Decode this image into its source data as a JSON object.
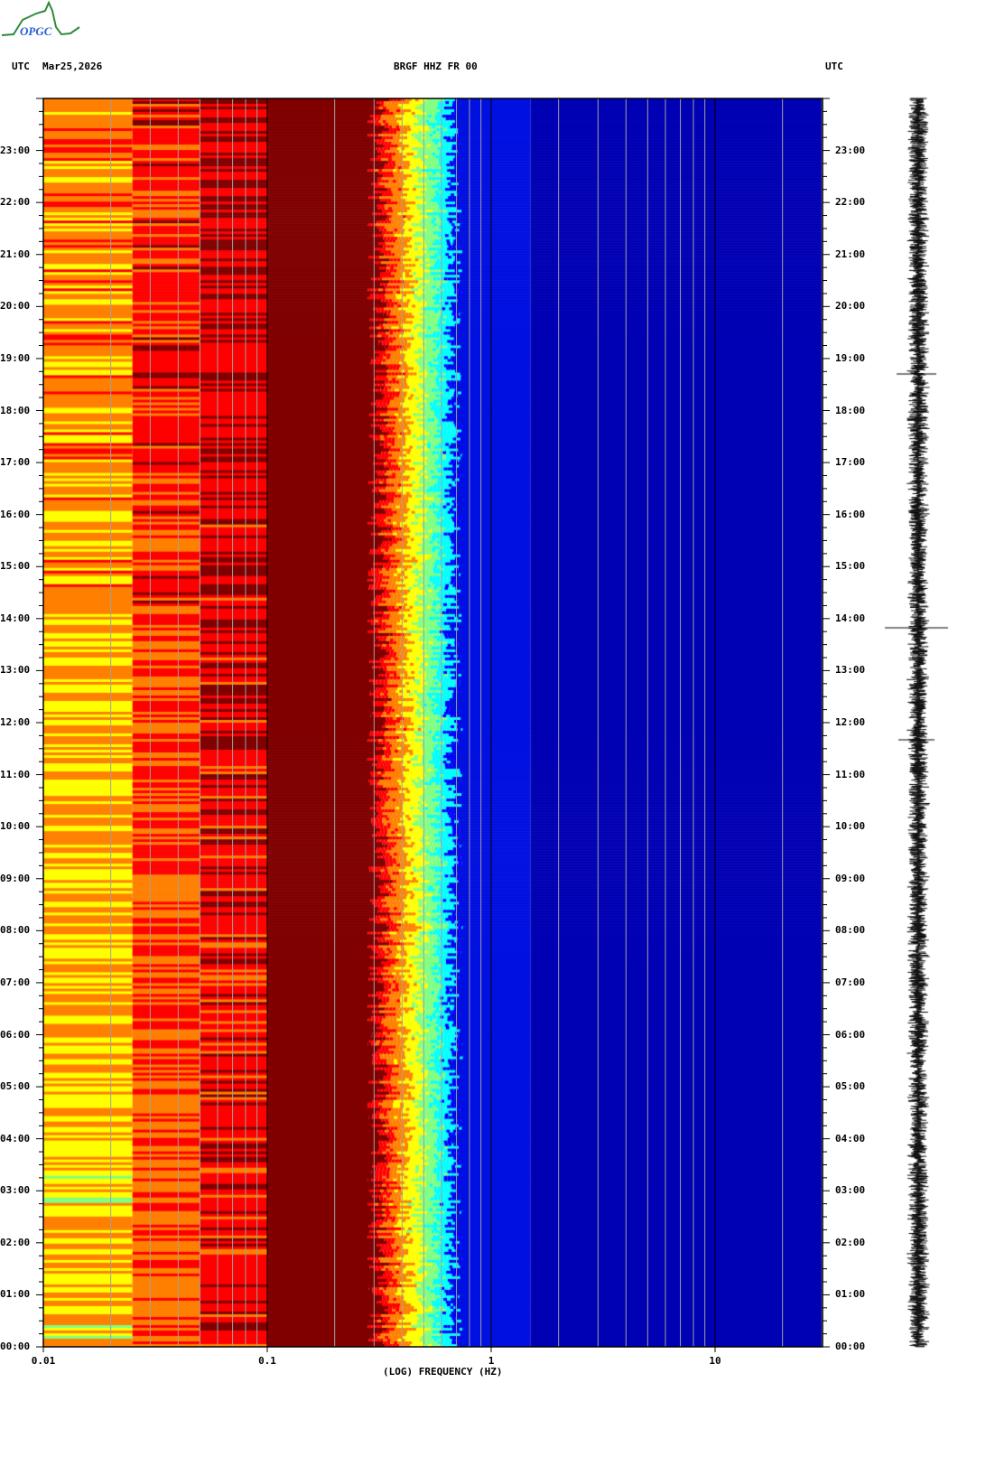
{
  "logo": {
    "text": "OPGC",
    "colors": {
      "curve": "#2e8b3a",
      "text": "#2a5fd0"
    }
  },
  "header": {
    "left_tz": "UTC",
    "date": "Mar25,2026",
    "station": "BRGF HHZ FR 00",
    "right_tz": "UTC"
  },
  "chart_data": {
    "type": "heatmap",
    "title": "BRGF HHZ FR 00",
    "xlabel": "(LOG) FREQUENCY (HZ)",
    "ylabel": "UTC",
    "x_scale": "log",
    "xlim": [
      0.01,
      30
    ],
    "x_ticks": [
      "0.01",
      "0.1",
      "1",
      "10"
    ],
    "x_tick_values": [
      0.01,
      0.1,
      1,
      10
    ],
    "ylim_hours": [
      0,
      24
    ],
    "y_ticks": [
      "00:00",
      "01:00",
      "02:00",
      "03:00",
      "04:00",
      "05:00",
      "06:00",
      "07:00",
      "08:00",
      "09:00",
      "10:00",
      "11:00",
      "12:00",
      "13:00",
      "14:00",
      "15:00",
      "16:00",
      "17:00",
      "18:00",
      "19:00",
      "20:00",
      "21:00",
      "22:00",
      "23:00"
    ],
    "y_tick_values": [
      0,
      1,
      2,
      3,
      4,
      5,
      6,
      7,
      8,
      9,
      10,
      11,
      12,
      13,
      14,
      15,
      16,
      17,
      18,
      19,
      20,
      21,
      22,
      23
    ],
    "frequency_bands": [
      {
        "from_hz": 0.01,
        "to_hz": 0.025,
        "level": "yellow-green with orange stripes"
      },
      {
        "from_hz": 0.025,
        "to_hz": 0.05,
        "level": "orange-red"
      },
      {
        "from_hz": 0.05,
        "to_hz": 0.1,
        "level": "red-dark red"
      },
      {
        "from_hz": 0.1,
        "to_hz": 0.3,
        "level": "dark red (max)"
      },
      {
        "from_hz": 0.3,
        "to_hz": 0.6,
        "level": "red to cyan transition"
      },
      {
        "from_hz": 0.6,
        "to_hz": 30,
        "level": "blue (low)"
      }
    ],
    "colormap": [
      "#00008c",
      "#0000ff",
      "#00ffff",
      "#80ff80",
      "#ffff00",
      "#ff8000",
      "#ff0000",
      "#800000"
    ],
    "grid": true
  }
}
